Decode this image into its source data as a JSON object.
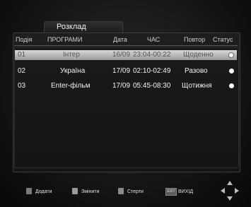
{
  "window": {
    "title": "Розклад"
  },
  "columns": [
    "Подія",
    "ПРОГРАМИ",
    "Дата",
    "ЧАС",
    "Повтор",
    "Статус"
  ],
  "rows": [
    {
      "event": "01",
      "program": "Інтер",
      "date": "16/09",
      "time": "23:04-00:22",
      "repeat": "Щоденно",
      "status": "inactive",
      "selected": true
    },
    {
      "event": "02",
      "program": "Україна",
      "date": "17/09",
      "time": "02:10-02:49",
      "repeat": "Разово",
      "status": "active",
      "selected": false
    },
    {
      "event": "03",
      "program": "Enter-фільм",
      "date": "17/09",
      "time": "05:45-08:30",
      "repeat": "Щотижня",
      "status": "active",
      "selected": false
    }
  ],
  "footer": {
    "add_label": "Додати",
    "edit_label": "Змінити",
    "delete_label": "Стерти",
    "exit_key_label": "EXIT",
    "exit_label": "ВИХІД",
    "add_color": "#7a7a7a",
    "edit_color": "#9a9a9a",
    "delete_color": "#8a8a8a"
  }
}
